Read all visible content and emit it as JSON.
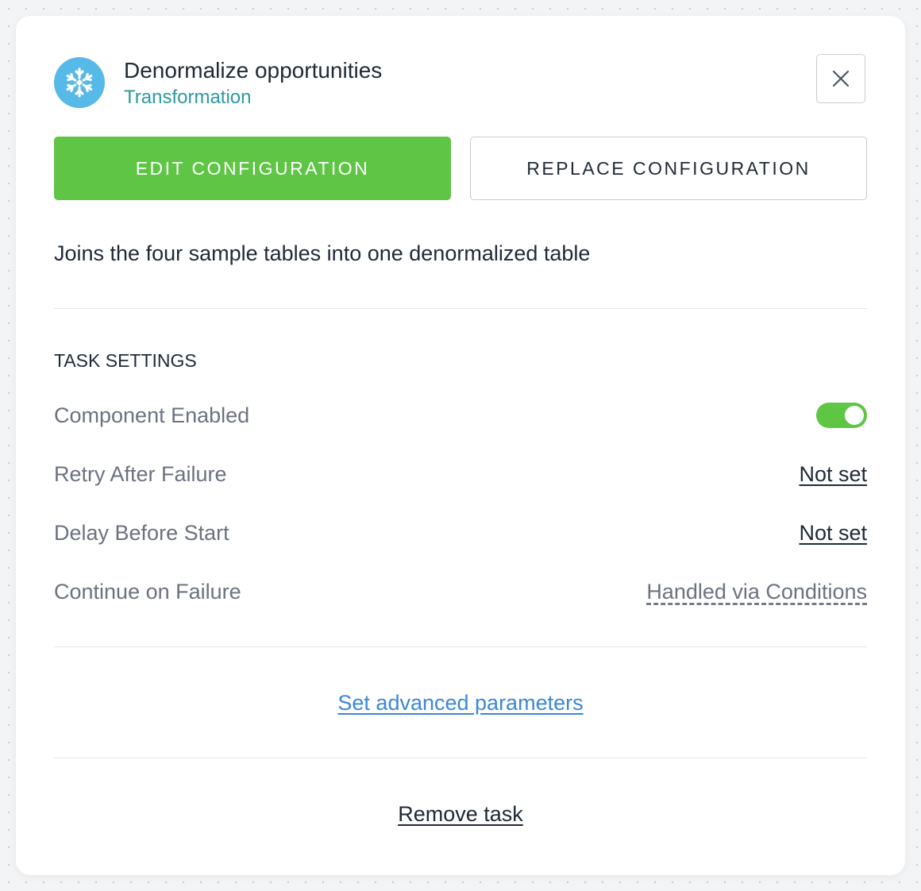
{
  "header": {
    "title": "Denormalize opportunities",
    "subtitle": "Transformation",
    "logo_icon": "snowflake-icon",
    "logo_color": "#56b9e8",
    "close_icon": "close-icon"
  },
  "actions": {
    "edit_label": "EDIT CONFIGURATION",
    "replace_label": "REPLACE CONFIGURATION",
    "edit_color": "#5fc545"
  },
  "description": "Joins the four sample tables into one denormalized table",
  "task_settings": {
    "title": "TASK SETTINGS",
    "component_enabled": {
      "label": "Component Enabled",
      "value": true
    },
    "retry_after_failure": {
      "label": "Retry After Failure",
      "value": "Not set"
    },
    "delay_before_start": {
      "label": "Delay Before Start",
      "value": "Not set"
    },
    "continue_on_failure": {
      "label": "Continue on Failure",
      "value": "Handled via Conditions"
    }
  },
  "links": {
    "advanced": "Set advanced parameters",
    "remove": "Remove task"
  }
}
